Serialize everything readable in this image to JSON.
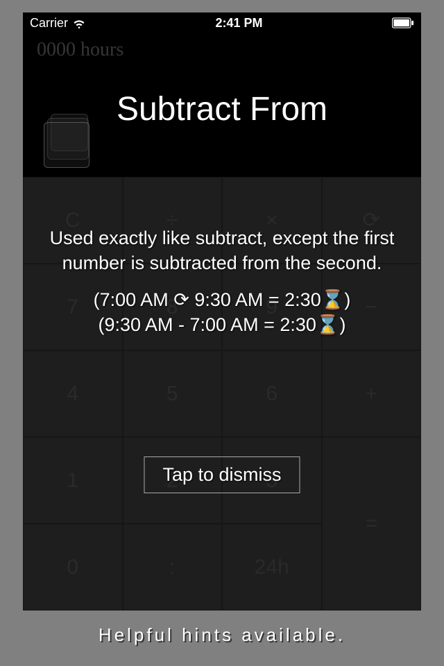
{
  "status": {
    "carrier": "Carrier",
    "time": "2:41 PM"
  },
  "display": {
    "hours_text": "0000 hours"
  },
  "keypad": {
    "rows": [
      [
        "C",
        "÷",
        "×",
        "⟳"
      ],
      [
        "7",
        "8",
        "9",
        "−"
      ],
      [
        "4",
        "5",
        "6",
        "+"
      ],
      [
        "1",
        "2",
        "3",
        "="
      ],
      [
        "0",
        ":",
        "24h",
        ""
      ]
    ]
  },
  "overlay": {
    "title": "Subtract From",
    "body_line1": "Used exactly like subtract, except the first number is subtracted from the second.",
    "body_line2": "(7:00 AM ⟳ 9:30 AM = 2:30⌛)",
    "body_line3": "(9:30 AM - 7:00 AM = 2:30⌛)",
    "dismiss_label": "Tap to dismiss"
  },
  "footer": {
    "caption": "Helpful hints available."
  }
}
